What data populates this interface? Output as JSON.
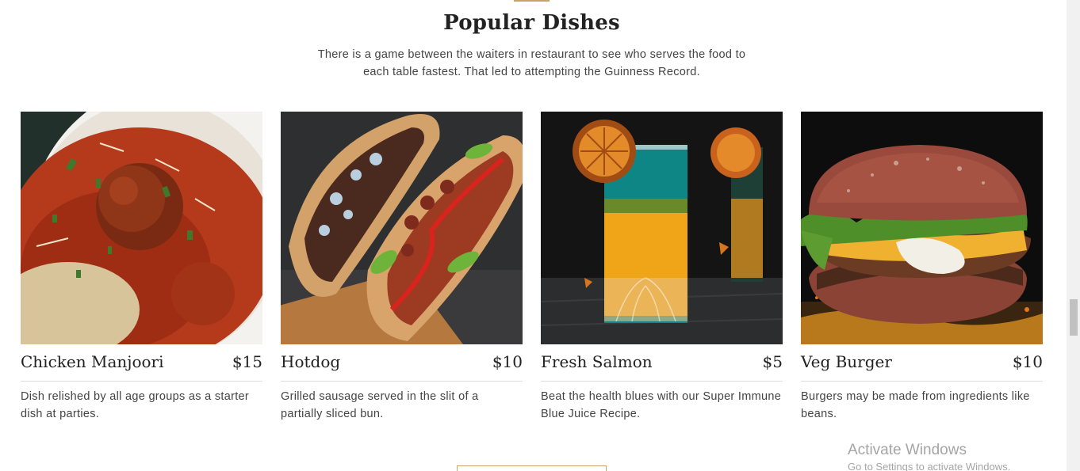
{
  "section": {
    "title": "Popular Dishes",
    "description": "There is a game between the waiters in restaurant to see who serves the food to each table fastest. That led to attempting the Guinness Record."
  },
  "dishes": [
    {
      "name": "Chicken Manjoori",
      "price": "$15",
      "description": "Dish relished by all age groups as a starter dish at parties.",
      "image_icon": "pasta-meatball-photo"
    },
    {
      "name": "Hotdog",
      "price": "$10",
      "description": "Grilled sausage served in the slit of a partially sliced bun.",
      "image_icon": "hotdog-photo"
    },
    {
      "name": "Fresh Salmon",
      "price": "$5",
      "description": "Beat the health blues with our Super Immune Blue Juice Recipe.",
      "image_icon": "juice-glass-photo"
    },
    {
      "name": "Veg Burger",
      "price": "$10",
      "description": "Burgers may be made from ingredients like beans.",
      "image_icon": "burger-photo"
    }
  ],
  "activate_windows": {
    "title": "Activate Windows",
    "subtitle": "Go to Settings to activate Windows."
  },
  "colors": {
    "accent": "#c9a46a",
    "text": "#222222",
    "muted_text": "#444444"
  }
}
